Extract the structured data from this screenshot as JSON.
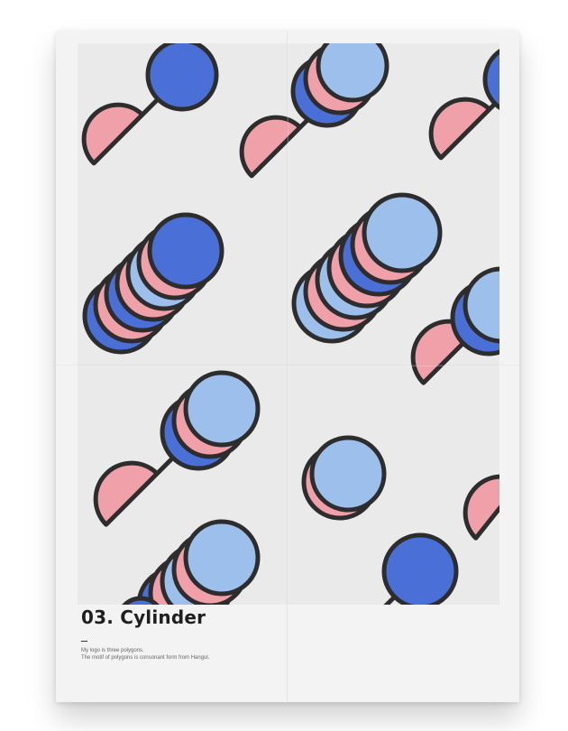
{
  "poster": {
    "title": "03. Cylinder",
    "description_line1": "My logo is three polygons.",
    "description_line2": "The motif of polygons is consonant form from Hangul."
  },
  "palette": {
    "paper": "#f3f3f3",
    "art_background": "#eaeaea",
    "outline": "#2d2d2d",
    "pink": "#f0a0a8",
    "blue_dark": "#4a6fd6",
    "blue_light": "#9dbfec"
  }
}
